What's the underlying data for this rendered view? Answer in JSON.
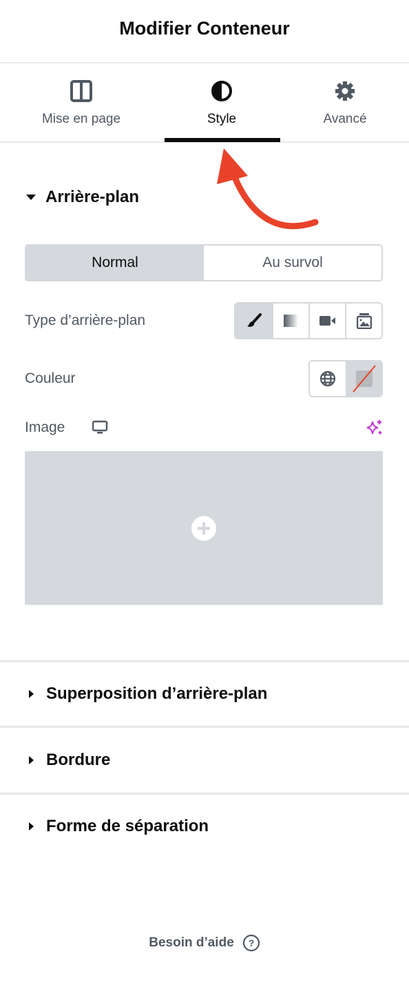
{
  "header": {
    "title": "Modifier Conteneur"
  },
  "tabs": [
    {
      "label": "Mise en page",
      "icon": "columns-icon"
    },
    {
      "label": "Style",
      "icon": "contrast-icon",
      "active": true
    },
    {
      "label": "Avancé",
      "icon": "gear-icon"
    }
  ],
  "background": {
    "title": "Arrière-plan",
    "states": [
      "Normal",
      "Au survol"
    ],
    "type_label": "Type d’arrière-plan",
    "type_options": [
      "brush-icon",
      "gradient-icon",
      "video-icon",
      "slideshow-icon"
    ],
    "color_label": "Couleur",
    "image_label": "Image"
  },
  "sections": [
    "Superposition d’arrière-plan",
    "Bordure",
    "Forme de séparation"
  ],
  "footer": {
    "help": "Besoin d’aide"
  },
  "colors": {
    "arrow": "#e8432a",
    "ai": "#c036d3"
  }
}
